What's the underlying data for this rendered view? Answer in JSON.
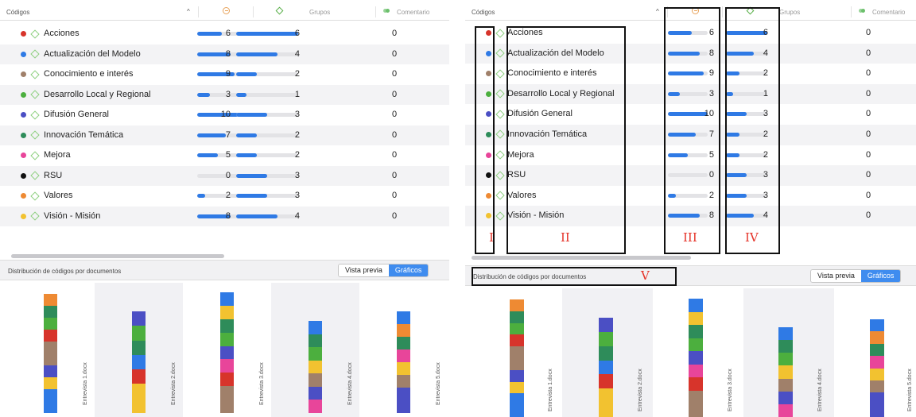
{
  "header": {
    "codes_label": "Códigos",
    "groups_label": "Grupos",
    "comment_label": "Comentario",
    "sort_glyph": "^"
  },
  "codes": [
    {
      "name": "Acciones",
      "color": "#d7342b",
      "freq": 6,
      "freq_frac": 0.6,
      "docs": 6,
      "docs_frac": 1.0,
      "comments": 0
    },
    {
      "name": "Actualización del Modelo",
      "color": "#2f7ae5",
      "freq": 8,
      "freq_frac": 0.8,
      "docs": 4,
      "docs_frac": 0.67,
      "comments": 0
    },
    {
      "name": "Conocimiento e interés",
      "color": "#a0806a",
      "freq": 9,
      "freq_frac": 0.9,
      "docs": 2,
      "docs_frac": 0.33,
      "comments": 0
    },
    {
      "name": "Desarrollo Local y Regional",
      "color": "#4caf3e",
      "freq": 3,
      "freq_frac": 0.3,
      "docs": 1,
      "docs_frac": 0.17,
      "comments": 0
    },
    {
      "name": "Difusión General",
      "color": "#4b4fc4",
      "freq": 10,
      "freq_frac": 1.0,
      "docs": 3,
      "docs_frac": 0.5,
      "comments": 0
    },
    {
      "name": "Innovación Temática",
      "color": "#2e8c5a",
      "freq": 7,
      "freq_frac": 0.7,
      "docs": 2,
      "docs_frac": 0.33,
      "comments": 0
    },
    {
      "name": "Mejora",
      "color": "#e8459a",
      "freq": 5,
      "freq_frac": 0.5,
      "docs": 2,
      "docs_frac": 0.33,
      "comments": 0
    },
    {
      "name": "RSU",
      "color": "#111111",
      "freq": 0,
      "freq_frac": 0.0,
      "docs": 3,
      "docs_frac": 0.5,
      "comments": 0
    },
    {
      "name": "Valores",
      "color": "#ee8a33",
      "freq": 2,
      "freq_frac": 0.2,
      "docs": 3,
      "docs_frac": 0.5,
      "comments": 0
    },
    {
      "name": "Visión - Misión",
      "color": "#f2c230",
      "freq": 8,
      "freq_frac": 0.8,
      "docs": 4,
      "docs_frac": 0.67,
      "comments": 0
    }
  ],
  "distribution": {
    "title": "Distribución de códigos por documentos",
    "preview_label": "Vista previa",
    "charts_label": "Gráficos"
  },
  "documents": [
    {
      "label": "Entrevista 1.docx",
      "stack": [
        "#ee8a33",
        "#2e8c5a",
        "#4caf3e",
        "#d7342b",
        "#a0806a",
        "#a0806a",
        "#4b4fc4",
        "#f2c230",
        "#2f7ae5",
        "#2f7ae5"
      ]
    },
    {
      "label": "Entrevista 2.docx",
      "stack": [
        "#4b4fc4",
        "#4caf3e",
        "#2e8c5a",
        "#2f7ae5",
        "#d7342b",
        "#f2c230",
        "#f2c230"
      ]
    },
    {
      "label": "Entrevista 3.docx",
      "stack": [
        "#2f7ae5",
        "#f2c230",
        "#2e8c5a",
        "#4caf3e",
        "#4b4fc4",
        "#e8459a",
        "#d7342b",
        "#a0806a",
        "#a0806a"
      ]
    },
    {
      "label": "Entrevista 4.docx",
      "stack": [
        "#2f7ae5",
        "#2e8c5a",
        "#4caf3e",
        "#f2c230",
        "#a0806a",
        "#4b4fc4",
        "#e8459a"
      ]
    },
    {
      "label": "Entrevista 5.docx",
      "stack": [
        "#2f7ae5",
        "#ee8a33",
        "#2e8c5a",
        "#e8459a",
        "#f2c230",
        "#a0806a",
        "#4b4fc4",
        "#4b4fc4"
      ]
    }
  ],
  "annotations": {
    "I": "I",
    "II": "II",
    "III": "III",
    "IV": "IV",
    "V": "V"
  }
}
